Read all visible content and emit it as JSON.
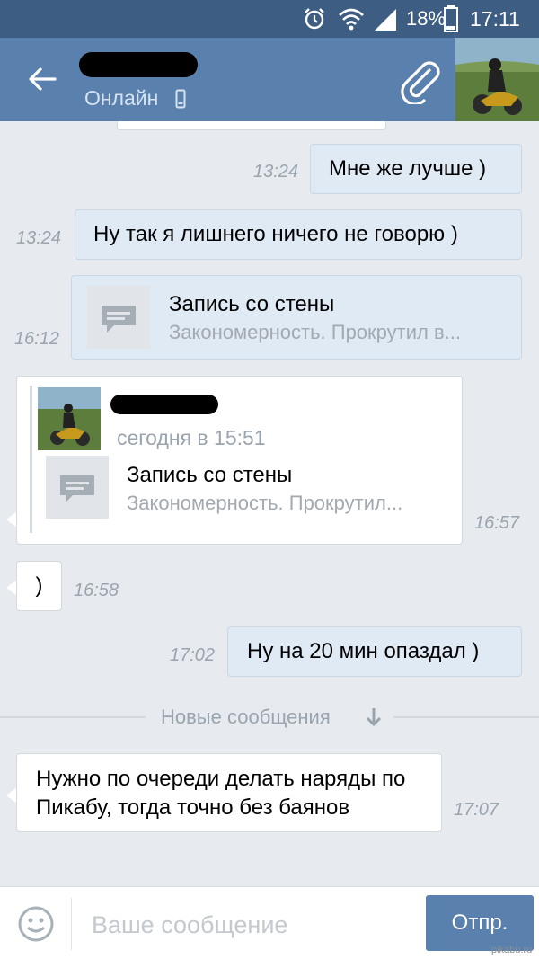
{
  "status": {
    "battery": "18%",
    "time": "17:11"
  },
  "header": {
    "status_text": "Онлайн"
  },
  "messages": [
    {
      "dir": "out",
      "time": "13:24",
      "text": "Мне же лучше )"
    },
    {
      "dir": "out",
      "time": "13:24",
      "text": "Ну так я лишнего ничего не говорю )"
    },
    {
      "dir": "out",
      "time": "16:12",
      "wall": {
        "title": "Запись со стены",
        "snippet": "Закономерность.  Прокрутил в..."
      }
    },
    {
      "dir": "in",
      "time": "16:57",
      "forwarded": {
        "meta": "сегодня в 15:51",
        "wall": {
          "title": "Запись со стены",
          "snippet": "Закономерность.  Прокрутил..."
        }
      }
    },
    {
      "dir": "in",
      "time": "16:58",
      "text": ")"
    },
    {
      "dir": "out",
      "time": "17:02",
      "text": "Ну на 20 мин опаздал )"
    },
    {
      "dir": "in",
      "time": "17:07",
      "text": "Нужно по очереди делать наряды по Пикабу, тогда точно без баянов"
    }
  ],
  "divider": {
    "label": "Новые сообщения"
  },
  "composer": {
    "placeholder": "Ваше сообщение",
    "send_label": "Отпр."
  },
  "watermark": "pikabu.ru",
  "colors": {
    "statusbar": "#3d5e82",
    "header": "#5a80ae",
    "background": "#e7ebf0",
    "outgoing_bubble": "#dfeaf5",
    "send_button": "#5a80ae"
  },
  "icons": [
    "alarm-icon",
    "wifi-icon",
    "signal-icon",
    "battery-icon",
    "back-arrow-icon",
    "phone-icon",
    "attach-icon",
    "wall-post-icon",
    "arrow-down-icon",
    "emoji-icon"
  ]
}
